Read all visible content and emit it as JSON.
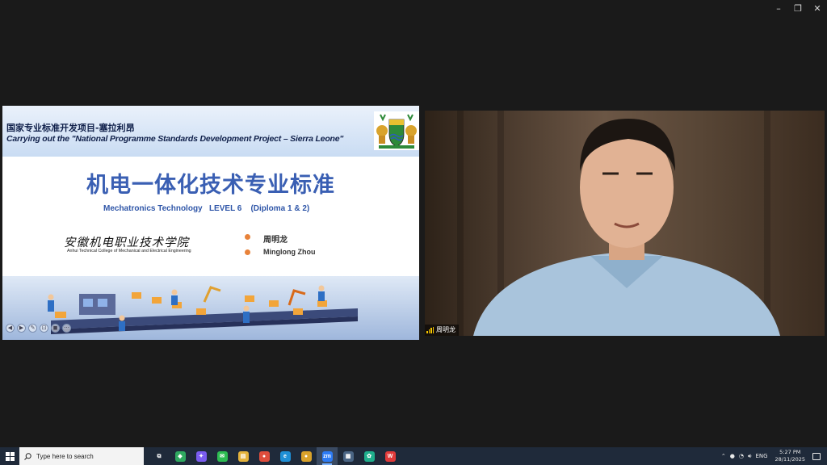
{
  "window": {
    "controls": [
      "–",
      "❐",
      "✕"
    ]
  },
  "slide": {
    "header_cn": "国家专业标准开发项目-塞拉利昂",
    "header_en": "Carrying out the \"National Programme Standards Development Project – Sierra Leone\"",
    "title": "机电一体化技术专业标准",
    "subtitle": "Mechatronics Technology   LEVEL 6    (Diploma 1 & 2)",
    "college_cn": "安徽机电职业技术学院",
    "college_en": "Anhui Technical College of Mechanical and Electrical Engineering",
    "author_cn": "周明龙",
    "author_en": "Minglong Zhou",
    "tools": [
      "◀",
      "▶",
      "✎",
      "⊡",
      "◼",
      "⋯"
    ]
  },
  "video": {
    "participant_name": "周明龙"
  },
  "taskbar": {
    "search_placeholder": "Type here to search",
    "apps": [
      {
        "name": "task-view",
        "glyph": "⧉",
        "color": "#1f2a3a"
      },
      {
        "name": "app-green",
        "glyph": "◆",
        "color": "#2fa860"
      },
      {
        "name": "copilot",
        "glyph": "✦",
        "color": "#7a5cf0"
      },
      {
        "name": "wechat",
        "glyph": "✉",
        "color": "#2dbb52"
      },
      {
        "name": "file-explorer",
        "glyph": "▤",
        "color": "#e3b23c"
      },
      {
        "name": "chrome",
        "glyph": "●",
        "color": "#de4d3c"
      },
      {
        "name": "edge",
        "glyph": "e",
        "color": "#1e8fd6"
      },
      {
        "name": "chrome-2",
        "glyph": "●",
        "color": "#d9a22a"
      },
      {
        "name": "zoom",
        "glyph": "zm",
        "color": "#2d7bf4"
      },
      {
        "name": "calculator",
        "glyph": "▦",
        "color": "#4a6584"
      },
      {
        "name": "app-teal",
        "glyph": "✿",
        "color": "#1fae8c"
      },
      {
        "name": "wps",
        "glyph": "W",
        "color": "#e03a3a"
      }
    ],
    "language": "ENG",
    "time": "5:27 PM",
    "date": "28/11/2025"
  }
}
